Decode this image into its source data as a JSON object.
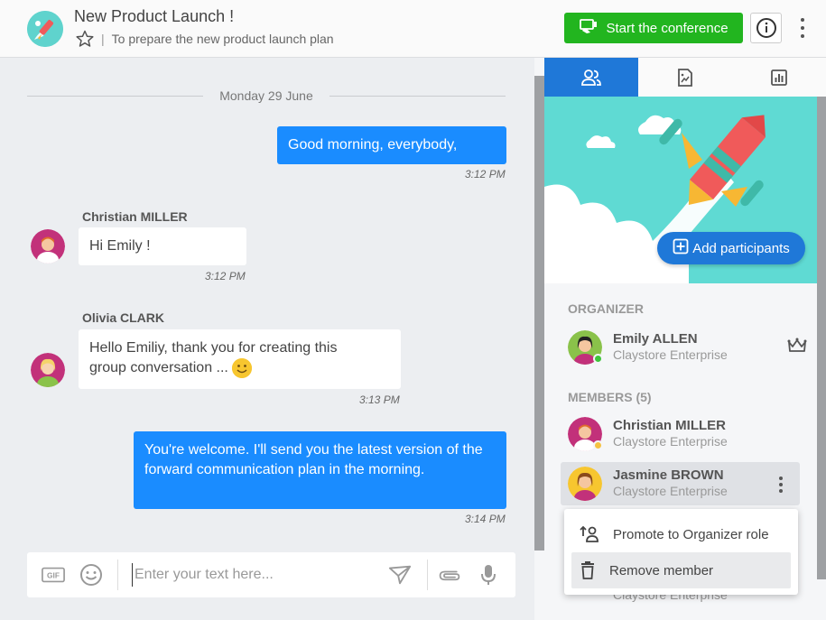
{
  "header": {
    "title": "New Product Launch !",
    "subtitle": "To prepare the new product launch plan",
    "separator": "|",
    "conference_button": "Start the conference"
  },
  "chat": {
    "date_divider": "Monday 29 June",
    "messages": [
      {
        "direction": "out",
        "text": "Good morning, everybody,",
        "time": "3:12 PM"
      },
      {
        "direction": "in",
        "sender": "Christian MILLER",
        "text": "Hi Emily !",
        "time": "3:12 PM"
      },
      {
        "direction": "in",
        "sender": "Olivia CLARK",
        "text_line1": "Hello Emiliy, thank you for creating this",
        "text_line2": "group conversation ...",
        "time": "3:13 PM"
      },
      {
        "direction": "out",
        "text": "You're welcome. I'll send you the latest version of the forward communication plan in the morning.",
        "time": "3:14 PM"
      }
    ]
  },
  "composer": {
    "placeholder": "Enter your text here...",
    "gif_label": "GIF"
  },
  "panel": {
    "add_participants": "Add participants",
    "organizer_label": "ORGANIZER",
    "organizer": {
      "name": "Emily ALLEN",
      "org": "Claystore Enterprise"
    },
    "members_label": "MEMBERS (5)",
    "members": [
      {
        "name": "Christian MILLER",
        "org": "Claystore Enterprise"
      },
      {
        "name": "Jasmine BROWN",
        "org": "Claystore Enterprise"
      }
    ],
    "peek_org": "Claystore Enterprise"
  },
  "context_menu": {
    "promote": "Promote to Organizer role",
    "remove": "Remove member"
  },
  "colors": {
    "accent": "#1f78d8",
    "bubble_out": "#1a8cff",
    "conference": "#22b51f",
    "status_online": "#3ec43b",
    "status_away": "#f5c242"
  }
}
